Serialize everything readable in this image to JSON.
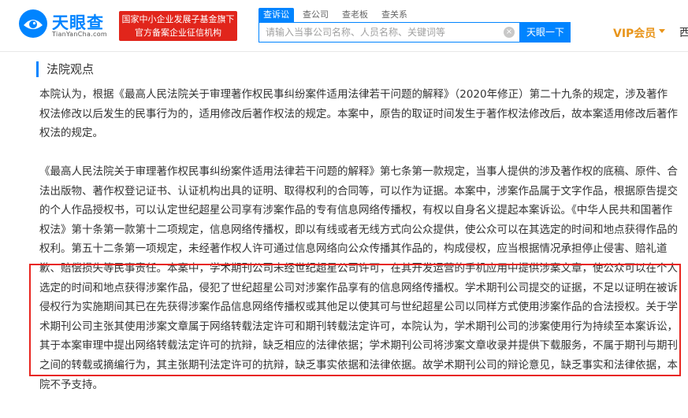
{
  "header": {
    "logo_cn": "天眼查",
    "logo_en": "TianYanCha.com",
    "banner_line1": "国家中小企业发展子基金旗下",
    "banner_line2": "官方备案企业征信机构",
    "search_tabs": [
      "查诉讼",
      "查公司",
      "查老板",
      "查关系"
    ],
    "search_placeholder": "请输入当事公司名称、人员名称、关键词等",
    "search_button": "天眼一下",
    "vip_label": "VIP会员",
    "nav_more": "西"
  },
  "content": {
    "section_title": "法院观点",
    "paragraph_1": "本院认为，根据《最高人民法院关于审理著作权民事纠纷案件适用法律若干问题的解释》（2020年修正）第二十九条的规定，涉及著作权法修改以后发生的民事行为的，适用修改后著作权法的规定。本案中，原告的取证时间发生于著作权法修改后，故本案适用修改后著作权法的规定。",
    "paragraph_2": "《最高人民法院关于审理著作权民事纠纷案件适用法律若干问题的解释》第七条第一款规定，当事人提供的涉及著作权的底稿、原件、合法出版物、著作权登记证书、认证机构出具的证明、取得权利的合同等，可以作为证据。本案中，涉案作品属于文字作品，根据原告提交的个人作品授权书，可以认定世纪超星公司享有涉案作品的专有信息网络传播权，有权以自身名义提起本案诉讼。《中华人民共和国著作权法》第十条第一款第十二项规定，信息网络传播权，即以有线或者无线方式向公众提供，使公众可以在其选定的时间和地点获得作品的权利。第五十二条第一项规定，未经著作权人许可通过信息网络向公众传播其作品的，构成侵权，应当根据情况承担停止侵害、赔礼道歉、赔偿损失等民事责任。本案中，学术期刊公司未经世纪超星公司许可，在其开发运营的手机应用中提供涉案文章，使公众可以在个人选定的时间和地点获得涉案作品，侵犯了世纪超星公司对涉案作品享有的信息网络传播权。学术期刊公司提交的证据，不足以证明在被诉侵权行为实施期间其已在先获得涉案作品信息网络传播权或其他足以使其可与世纪超星公司以同样方式使用涉案作品的合法授权。关于学术期刊公司主张其使用涉案文章属于网络转载法定许可和期刊转载法定许可，本院认为，学术期刊公司的涉案使用行为持续至本案诉讼，其于本案审理中提出网络转载法定许可的抗辩，缺乏相应的法律依据；学术期刊公司将涉案文章收录并提供下载服务，不属于期刊与期刊之间的转载或摘编行为，其主张期刊法定许可的抗辩，缺乏事实依据和法律依据。故学术期刊公司的辩论意见，缺乏事实和法律依据，本院不予支持。"
  },
  "colors": {
    "brand_blue": "#0084ff",
    "banner_red": "#e1251b",
    "highlight_red": "#e8251f",
    "vip_orange": "#e8941a"
  }
}
